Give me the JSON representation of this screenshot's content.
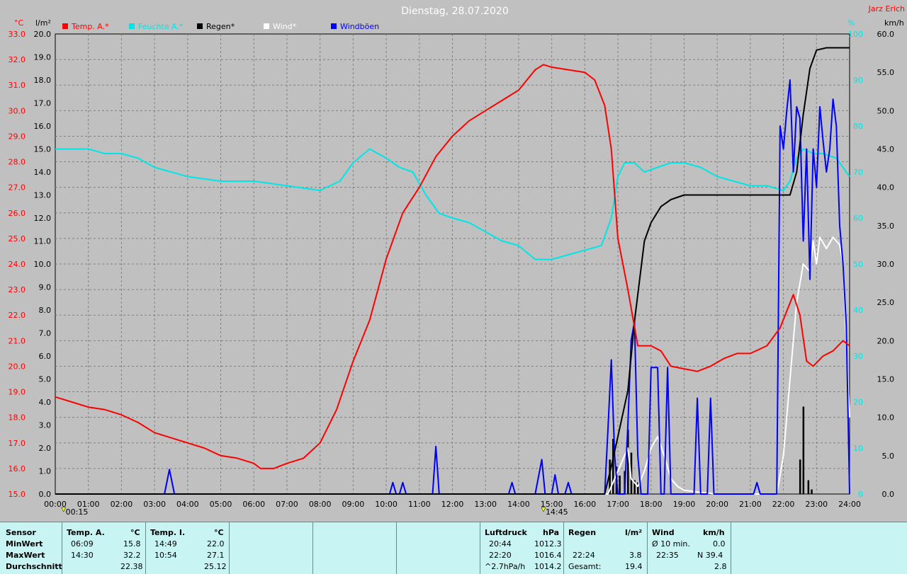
{
  "chart_data": {
    "type": "line",
    "title": "Dienstag, 28.07.2020",
    "author": "Jarz Erich",
    "axis_units": {
      "temp": "°C",
      "rain": "l/m²",
      "humidity": "%",
      "wind": "km/h"
    },
    "temp_axis": {
      "min": 15.0,
      "max": 33.0,
      "ticks": [
        "15.0",
        "16.0",
        "17.0",
        "18.0",
        "19.0",
        "20.0",
        "21.0",
        "22.0",
        "23.0",
        "24.0",
        "25.0",
        "26.0",
        "27.0",
        "28.0",
        "29.0",
        "30.0",
        "31.0",
        "32.0",
        "33.0"
      ]
    },
    "rain_axis": {
      "min": 0.0,
      "max": 20.0,
      "ticks": [
        "0.0",
        "1.0",
        "2.0",
        "3.0",
        "4.0",
        "5.0",
        "6.0",
        "7.0",
        "8.0",
        "9.0",
        "10.0",
        "11.0",
        "12.0",
        "13.0",
        "14.0",
        "15.0",
        "16.0",
        "17.0",
        "18.0",
        "19.0",
        "20.0"
      ]
    },
    "humidity_axis": {
      "min": 0,
      "max": 100,
      "ticks": [
        "0",
        "10",
        "20",
        "30",
        "40",
        "50",
        "60",
        "70",
        "80",
        "90",
        "100"
      ]
    },
    "wind_axis": {
      "min": 0.0,
      "max": 60.0,
      "ticks": [
        "0.0",
        "5.0",
        "10.0",
        "15.0",
        "20.0",
        "25.0",
        "30.0",
        "35.0",
        "40.0",
        "45.0",
        "50.0",
        "55.0",
        "60.0"
      ]
    },
    "x_axis": {
      "min": 0,
      "max": 24,
      "ticks": [
        "00:00",
        "01:00",
        "02:00",
        "03:00",
        "04:00",
        "05:00",
        "06:00",
        "07:00",
        "08:00",
        "09:00",
        "10:00",
        "11:00",
        "12:00",
        "13:00",
        "14:00",
        "15:00",
        "16:00",
        "17:00",
        "18:00",
        "19:00",
        "20:00",
        "21:00",
        "22:00",
        "23:00",
        "24:00"
      ]
    },
    "markers": [
      {
        "label": "00:15",
        "x": 0.25
      },
      {
        "label": "14:45",
        "x": 14.75
      }
    ],
    "grid": true,
    "series": [
      {
        "name": "Temp. A.*",
        "color": "#ff0000",
        "axis": "temp",
        "points": [
          [
            0,
            18.8
          ],
          [
            0.5,
            18.6
          ],
          [
            1,
            18.4
          ],
          [
            1.5,
            18.3
          ],
          [
            2,
            18.1
          ],
          [
            2.5,
            17.8
          ],
          [
            3,
            17.4
          ],
          [
            3.5,
            17.2
          ],
          [
            4,
            17.0
          ],
          [
            4.5,
            16.8
          ],
          [
            5,
            16.5
          ],
          [
            5.5,
            16.4
          ],
          [
            6,
            16.2
          ],
          [
            6.2,
            16.0
          ],
          [
            6.6,
            16.0
          ],
          [
            7,
            16.2
          ],
          [
            7.5,
            16.4
          ],
          [
            8,
            17.0
          ],
          [
            8.5,
            18.3
          ],
          [
            9,
            20.2
          ],
          [
            9.5,
            21.8
          ],
          [
            10,
            24.2
          ],
          [
            10.5,
            26.0
          ],
          [
            11,
            27.0
          ],
          [
            11.5,
            28.2
          ],
          [
            12,
            29.0
          ],
          [
            12.5,
            29.6
          ],
          [
            13,
            30.0
          ],
          [
            13.5,
            30.4
          ],
          [
            14,
            30.8
          ],
          [
            14.5,
            31.6
          ],
          [
            14.75,
            31.8
          ],
          [
            15,
            31.7
          ],
          [
            15.5,
            31.6
          ],
          [
            16,
            31.5
          ],
          [
            16.3,
            31.2
          ],
          [
            16.6,
            30.2
          ],
          [
            16.8,
            28.5
          ],
          [
            17,
            25.0
          ],
          [
            17.3,
            23.0
          ],
          [
            17.6,
            20.8
          ],
          [
            18,
            20.8
          ],
          [
            18.3,
            20.6
          ],
          [
            18.6,
            20.0
          ],
          [
            19,
            19.9
          ],
          [
            19.4,
            19.8
          ],
          [
            19.8,
            20.0
          ],
          [
            20.2,
            20.3
          ],
          [
            20.6,
            20.5
          ],
          [
            21,
            20.5
          ],
          [
            21.5,
            20.8
          ],
          [
            21.9,
            21.5
          ],
          [
            22.3,
            22.8
          ],
          [
            22.5,
            22.0
          ],
          [
            22.7,
            20.2
          ],
          [
            22.9,
            20.0
          ],
          [
            23.2,
            20.4
          ],
          [
            23.5,
            20.6
          ],
          [
            23.8,
            21.0
          ],
          [
            24,
            20.8
          ]
        ]
      },
      {
        "name": "Feuchte A.*",
        "color": "#00e6e6",
        "axis": "humidity",
        "points": [
          [
            0,
            75
          ],
          [
            0.5,
            75
          ],
          [
            1,
            75
          ],
          [
            1.5,
            74
          ],
          [
            2,
            74
          ],
          [
            2.5,
            73
          ],
          [
            3,
            71
          ],
          [
            3.5,
            70
          ],
          [
            4,
            69
          ],
          [
            5,
            68
          ],
          [
            6,
            68
          ],
          [
            7,
            67
          ],
          [
            8,
            66
          ],
          [
            8.6,
            68
          ],
          [
            9,
            72
          ],
          [
            9.5,
            75
          ],
          [
            10,
            73
          ],
          [
            10.4,
            71
          ],
          [
            10.8,
            70
          ],
          [
            11.2,
            65
          ],
          [
            11.6,
            61
          ],
          [
            12,
            60
          ],
          [
            12.5,
            59
          ],
          [
            13,
            57
          ],
          [
            13.5,
            55
          ],
          [
            14,
            54
          ],
          [
            14.5,
            51
          ],
          [
            15,
            51
          ],
          [
            15.5,
            52
          ],
          [
            16,
            53
          ],
          [
            16.5,
            54
          ],
          [
            16.8,
            60
          ],
          [
            17,
            69
          ],
          [
            17.2,
            72
          ],
          [
            17.5,
            72
          ],
          [
            17.8,
            70
          ],
          [
            18.2,
            71
          ],
          [
            18.6,
            72
          ],
          [
            19,
            72
          ],
          [
            19.5,
            71
          ],
          [
            20,
            69
          ],
          [
            20.5,
            68
          ],
          [
            21,
            67
          ],
          [
            21.5,
            67
          ],
          [
            22,
            66
          ],
          [
            22.2,
            68
          ],
          [
            22.4,
            73
          ],
          [
            22.6,
            75
          ],
          [
            22.9,
            74
          ],
          [
            23.2,
            74
          ],
          [
            23.6,
            73
          ],
          [
            24,
            69
          ]
        ]
      },
      {
        "name": "Regen*",
        "color": "#000000",
        "axis": "rain",
        "points": [
          [
            0,
            0
          ],
          [
            16.6,
            0
          ],
          [
            16.8,
            1.2
          ],
          [
            17,
            2.5
          ],
          [
            17.3,
            4.5
          ],
          [
            17.5,
            7.5
          ],
          [
            17.8,
            11.0
          ],
          [
            18,
            11.8
          ],
          [
            18.3,
            12.5
          ],
          [
            18.6,
            12.8
          ],
          [
            19,
            13.0
          ],
          [
            20,
            13.0
          ],
          [
            21,
            13.0
          ],
          [
            21.5,
            13.0
          ],
          [
            22.2,
            13.0
          ],
          [
            22.4,
            14.0
          ],
          [
            22.6,
            16.5
          ],
          [
            22.8,
            18.5
          ],
          [
            23,
            19.3
          ],
          [
            23.3,
            19.4
          ],
          [
            24,
            19.4
          ]
        ]
      },
      {
        "name": "Wind*",
        "color": "#ffffff",
        "axis": "wind",
        "points": [
          [
            0,
            0
          ],
          [
            16.7,
            0
          ],
          [
            16.9,
            2.0
          ],
          [
            17.1,
            4.0
          ],
          [
            17.3,
            6.0
          ],
          [
            17.4,
            2.0
          ],
          [
            17.6,
            1.0
          ],
          [
            17.8,
            3.0
          ],
          [
            18.0,
            6.0
          ],
          [
            18.2,
            7.5
          ],
          [
            18.4,
            5.0
          ],
          [
            18.6,
            2.0
          ],
          [
            18.8,
            1.0
          ],
          [
            19.0,
            0.5
          ],
          [
            19.5,
            0.2
          ],
          [
            20,
            0
          ],
          [
            21,
            0
          ],
          [
            21.8,
            0
          ],
          [
            22.0,
            5.0
          ],
          [
            22.2,
            15.0
          ],
          [
            22.4,
            25.0
          ],
          [
            22.6,
            30.0
          ],
          [
            22.8,
            29.0
          ],
          [
            22.9,
            33.0
          ],
          [
            23.0,
            30.0
          ],
          [
            23.1,
            33.5
          ],
          [
            23.3,
            32.0
          ],
          [
            23.5,
            33.5
          ],
          [
            23.7,
            32.5
          ],
          [
            23.8,
            30.0
          ],
          [
            24,
            10.0
          ]
        ]
      },
      {
        "name": "Windböen",
        "color": "#0000ff",
        "axis": "wind",
        "points": [
          [
            0,
            0
          ],
          [
            3.3,
            0
          ],
          [
            3.45,
            3.2
          ],
          [
            3.6,
            0
          ],
          [
            10.1,
            0
          ],
          [
            10.2,
            1.5
          ],
          [
            10.3,
            0
          ],
          [
            10.4,
            0
          ],
          [
            10.5,
            1.5
          ],
          [
            10.6,
            0
          ],
          [
            11.4,
            0
          ],
          [
            11.5,
            6.2
          ],
          [
            11.6,
            0
          ],
          [
            13.7,
            0
          ],
          [
            13.8,
            1.5
          ],
          [
            13.9,
            0
          ],
          [
            14.5,
            0
          ],
          [
            14.7,
            4.5
          ],
          [
            14.8,
            0
          ],
          [
            15.0,
            0
          ],
          [
            15.1,
            2.5
          ],
          [
            15.2,
            0
          ],
          [
            15.4,
            0
          ],
          [
            15.5,
            1.5
          ],
          [
            15.6,
            0
          ],
          [
            16.6,
            0
          ],
          [
            16.7,
            8.5
          ],
          [
            16.8,
            17.5
          ],
          [
            16.9,
            5.0
          ],
          [
            17.0,
            0
          ],
          [
            17.2,
            0
          ],
          [
            17.3,
            9.0
          ],
          [
            17.4,
            20.0
          ],
          [
            17.5,
            22.5
          ],
          [
            17.6,
            5.0
          ],
          [
            17.7,
            0
          ],
          [
            17.9,
            0
          ],
          [
            18.0,
            16.5
          ],
          [
            18.2,
            16.5
          ],
          [
            18.3,
            0
          ],
          [
            18.4,
            0
          ],
          [
            18.5,
            16.5
          ],
          [
            18.6,
            0
          ],
          [
            19.3,
            0
          ],
          [
            19.4,
            12.5
          ],
          [
            19.5,
            0
          ],
          [
            19.7,
            0
          ],
          [
            19.8,
            12.5
          ],
          [
            19.9,
            0
          ],
          [
            21.1,
            0
          ],
          [
            21.2,
            1.5
          ],
          [
            21.3,
            0
          ],
          [
            21.8,
            0
          ],
          [
            21.9,
            48.0
          ],
          [
            22.0,
            45.0
          ],
          [
            22.1,
            50.0
          ],
          [
            22.2,
            54.0
          ],
          [
            22.3,
            42.0
          ],
          [
            22.4,
            50.5
          ],
          [
            22.5,
            49.0
          ],
          [
            22.6,
            33.0
          ],
          [
            22.7,
            45.0
          ],
          [
            22.8,
            28.0
          ],
          [
            22.9,
            45.0
          ],
          [
            23.0,
            40.0
          ],
          [
            23.1,
            50.5
          ],
          [
            23.2,
            46.0
          ],
          [
            23.3,
            42.0
          ],
          [
            23.4,
            45.0
          ],
          [
            23.5,
            51.5
          ],
          [
            23.6,
            48.0
          ],
          [
            23.7,
            35.0
          ],
          [
            23.8,
            30.0
          ],
          [
            23.9,
            22.0
          ],
          [
            24.0,
            0
          ]
        ]
      },
      {
        "name": "Regen (Balken)",
        "color": "#000000",
        "axis": "rain",
        "style": "bars",
        "points": [
          [
            16.75,
            1.5
          ],
          [
            16.85,
            2.4
          ],
          [
            16.95,
            1.2
          ],
          [
            17.05,
            0.8
          ],
          [
            17.2,
            1.0
          ],
          [
            17.3,
            2.8
          ],
          [
            17.4,
            1.8
          ],
          [
            17.5,
            0.6
          ],
          [
            17.6,
            0.5
          ],
          [
            22.5,
            1.5
          ],
          [
            22.6,
            3.8
          ],
          [
            22.75,
            0.6
          ],
          [
            22.85,
            0.2
          ]
        ]
      }
    ]
  },
  "stats": {
    "headers": {
      "sensor": "Sensor",
      "temp_a": "Temp. A.",
      "temp_a_unit": "°C",
      "temp_i": "Temp. I.",
      "temp_i_unit": "°C",
      "pressure": "Luftdruck",
      "pressure_unit": "hPa",
      "rain": "Regen",
      "rain_unit": "l/m²",
      "wind": "Wind",
      "wind_unit": "km/h"
    },
    "rows": {
      "min": "MinWert",
      "max": "MaxWert",
      "avg": "Durchschnitt"
    },
    "temp_a": {
      "min_time": "06:09",
      "min": "15.8",
      "max_time": "14:30",
      "max": "32.2",
      "avg": "22.38"
    },
    "temp_i": {
      "min_time": "14:49",
      "min": "22.0",
      "max_time": "10:54",
      "max": "27.1",
      "avg": "25.12"
    },
    "pressure": {
      "min_time": "20:44",
      "min": "1012.3",
      "max_time": "22:20",
      "max": "1016.4",
      "trend": "^2.7hPa/h",
      "avg": "1014.2"
    },
    "rain": {
      "max_time": "22:24",
      "max": "3.8",
      "total_label": "Gesamt:",
      "total": "19.4"
    },
    "wind": {
      "avg10_label": "Ø 10 min.",
      "avg10": "0.0",
      "max_time": "22:35",
      "max": "N 39.4",
      "avg": "2.8"
    }
  }
}
